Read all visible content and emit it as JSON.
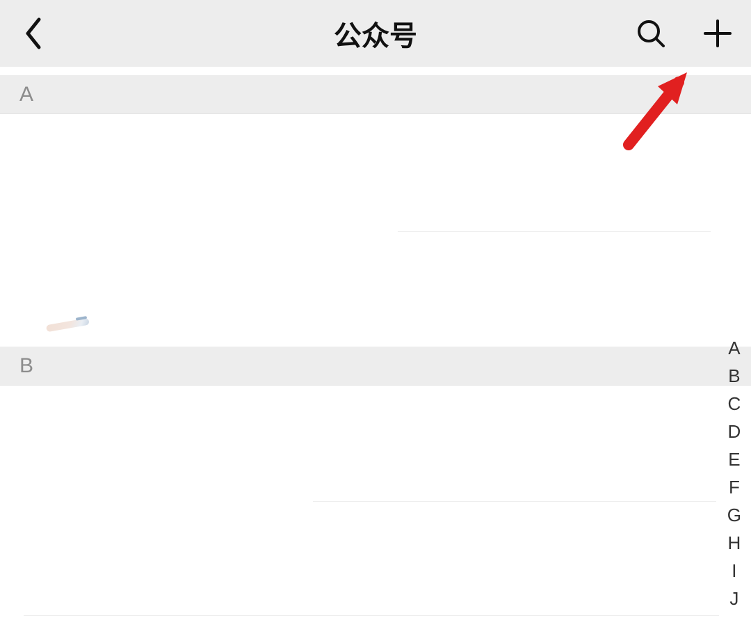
{
  "header": {
    "title": "公众号"
  },
  "sections": {
    "a": {
      "label": "A"
    },
    "b": {
      "label": "B"
    }
  },
  "alpha_index": {
    "letters": [
      "A",
      "B",
      "C",
      "D",
      "E",
      "F",
      "G",
      "H",
      "I",
      "J"
    ]
  },
  "annotation": {
    "arrow_color": "#e12020",
    "arrow_target": "add-button"
  }
}
